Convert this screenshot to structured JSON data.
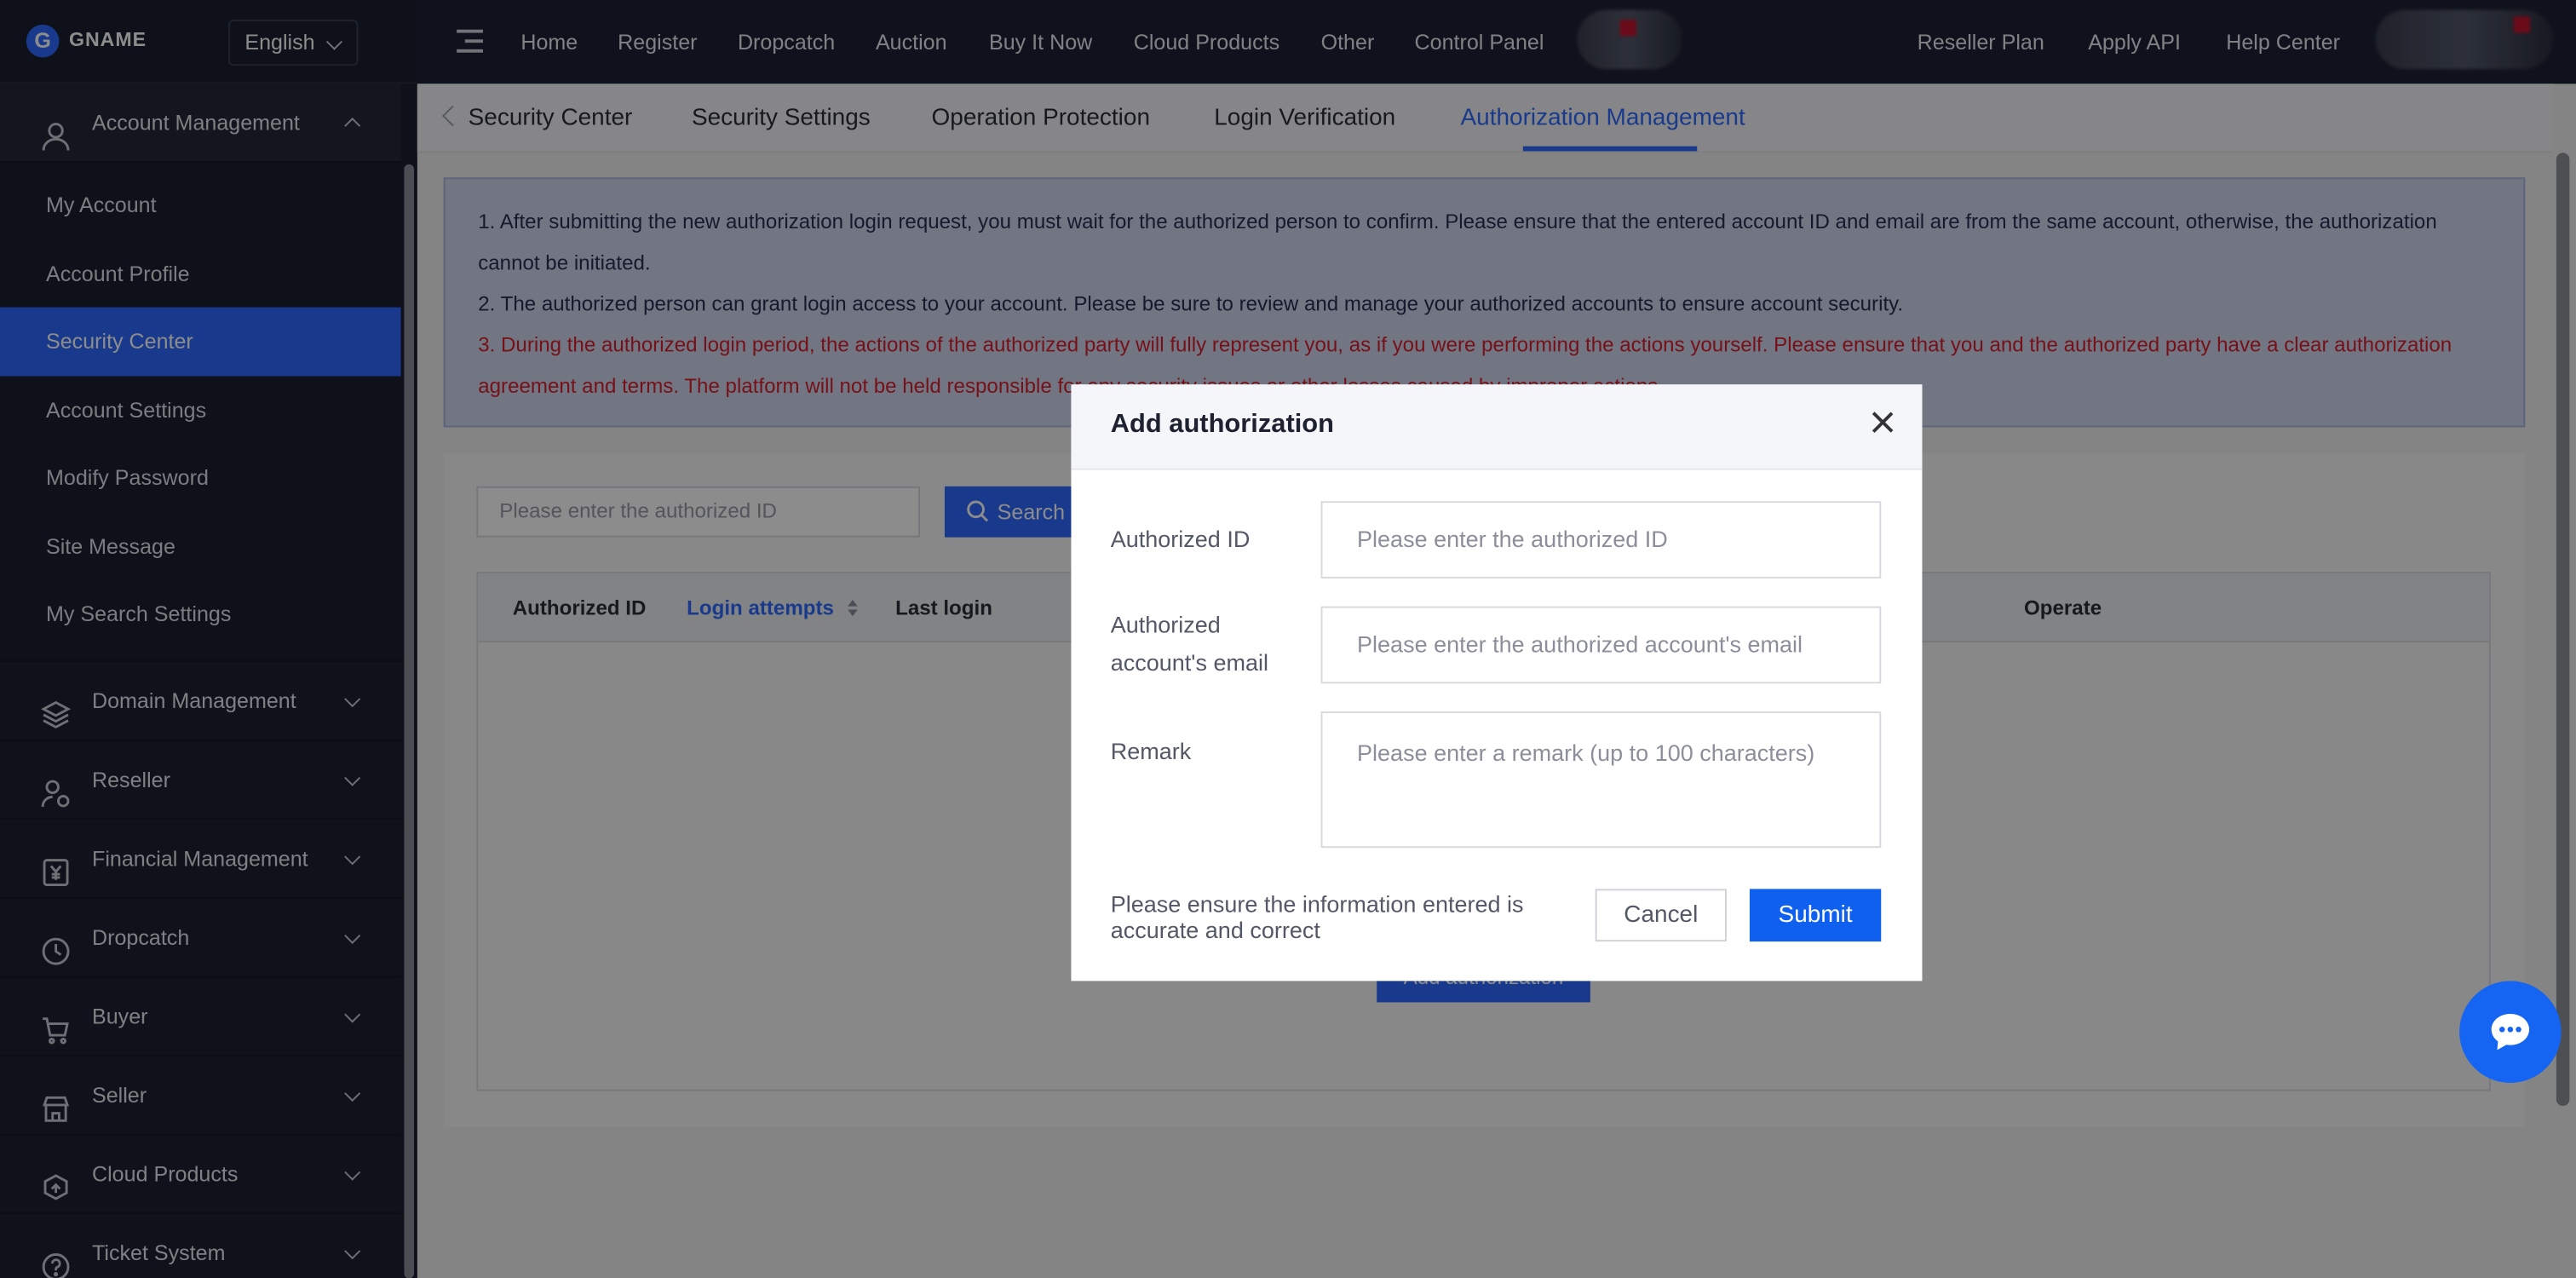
{
  "brand": {
    "name": "GNAME",
    "logo_letter": "G"
  },
  "language": {
    "selected": "English"
  },
  "sidebar": {
    "groups": [
      {
        "label": "Account Management",
        "icon": "user-icon",
        "open": true,
        "items": [
          "My Account",
          "Account Profile",
          "Security Center",
          "Account Settings",
          "Modify Password",
          "Site Message",
          "My Search Settings"
        ],
        "active": "Security Center"
      },
      {
        "label": "Domain Management",
        "icon": "layers-icon"
      },
      {
        "label": "Reseller",
        "icon": "reseller-icon"
      },
      {
        "label": "Financial Management",
        "icon": "yen-invoice-icon"
      },
      {
        "label": "Dropcatch",
        "icon": "clock-icon"
      },
      {
        "label": "Buyer",
        "icon": "cart-icon"
      },
      {
        "label": "Seller",
        "icon": "store-icon"
      },
      {
        "label": "Cloud Products",
        "icon": "cloud-upload-icon"
      },
      {
        "label": "Ticket System",
        "icon": "help-circle-icon"
      }
    ]
  },
  "topnav": {
    "left": [
      "Home",
      "Register",
      "Dropcatch",
      "Auction",
      "Buy It Now",
      "Cloud Products",
      "Other",
      "Control Panel"
    ],
    "right": [
      "Reseller Plan",
      "Apply API",
      "Help Center"
    ]
  },
  "subnav": {
    "tabs": [
      "Security Center",
      "Security Settings",
      "Operation Protection",
      "Login Verification",
      "Authorization Management"
    ],
    "active": "Authorization Management"
  },
  "notice": {
    "line1": "1. After submitting the new authorization login request, you must wait for the authorized person to confirm. Please ensure that the entered account ID and email are from the same account, otherwise, the authorization cannot be initiated.",
    "line2": "2. The authorized person can grant login access to your account. Please be sure to review and manage your authorized accounts to ensure account security.",
    "line3": "3. During the authorized login period, the actions of the authorized party will fully represent you, as if you were performing the actions yourself. Please ensure that you and the authorized party have a clear authorization agreement and terms. The platform will not be held responsible for any security issues or other losses caused by improper actions."
  },
  "search": {
    "placeholder": "Please enter the authorized ID",
    "button": "Search"
  },
  "table": {
    "columns": [
      "Authorized ID",
      "Login attempts",
      "Last login",
      "Operate"
    ],
    "sorted_column": "Login attempts",
    "empty_button": "Add authorization"
  },
  "modal": {
    "title": "Add authorization",
    "fields": [
      {
        "label": "Authorized ID",
        "placeholder": "Please enter the authorized ID"
      },
      {
        "label": "Authorized account's email",
        "placeholder": "Please enter the authorized account's email"
      },
      {
        "label": "Remark",
        "placeholder": "Please enter a remark (up to 100 characters)"
      }
    ],
    "hint": "Please ensure the information entered is accurate and correct",
    "cancel": "Cancel",
    "submit": "Submit"
  },
  "colors": {
    "accent": "#2f6bff",
    "sidebar_bg": "#1b1f2e",
    "topbar_bg": "#1d2233",
    "warning": "#d8202f"
  }
}
